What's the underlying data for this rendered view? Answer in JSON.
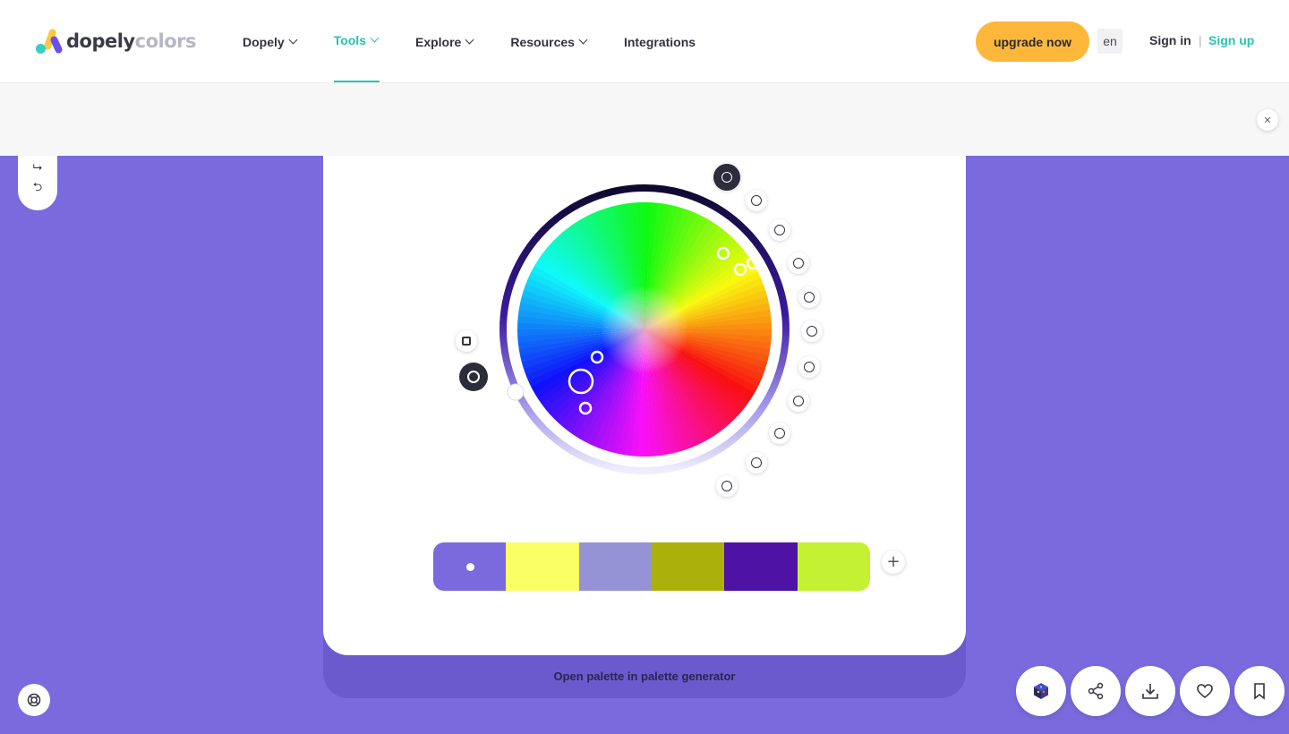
{
  "header": {
    "logo_part1": "dopely",
    "logo_part2": "colors",
    "nav": [
      {
        "label": "Dopely"
      },
      {
        "label": "Tools"
      },
      {
        "label": "Explore"
      },
      {
        "label": "Resources"
      },
      {
        "label": "Integrations"
      }
    ],
    "upgrade_label": "upgrade now",
    "language": "en",
    "sign_in": "Sign in",
    "separator": "|",
    "sign_up": "Sign up"
  },
  "history": {
    "redo_icon": "redo-icon",
    "undo_icon": "undo-icon"
  },
  "wheel": {
    "selected_color": "#7a6ade"
  },
  "palette": {
    "swatches": [
      "#7a6ade",
      "#faff66",
      "#9592d6",
      "#abb00b",
      "#4e13a4",
      "#c4f232"
    ],
    "add_label": "+"
  },
  "open_generator": "Open palette in palette generator",
  "colors": {
    "accent": "#29c2b5",
    "upgrade": "#fdb83c",
    "background": "#7a6ade"
  }
}
